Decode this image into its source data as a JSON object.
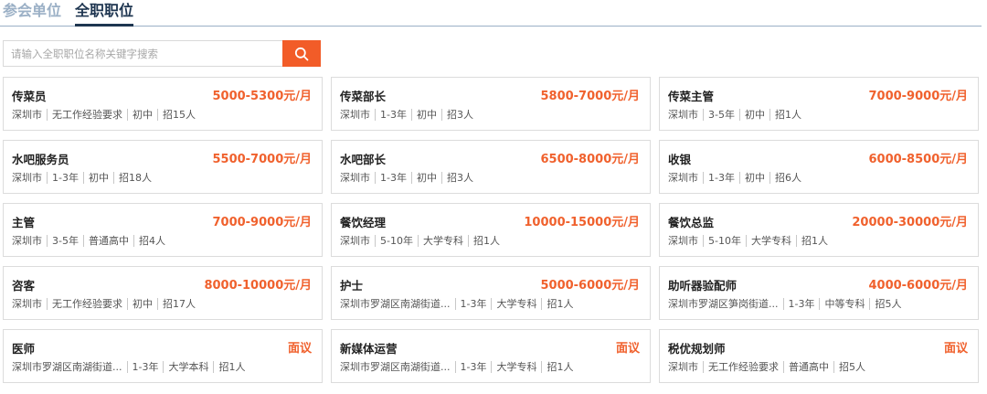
{
  "tabs": {
    "companies": "参会单位",
    "jobs": "全职职位"
  },
  "search": {
    "placeholder": "请输入全职职位名称关键字搜索"
  },
  "jobs": [
    {
      "title": "传菜员",
      "salary": "5000-5300元/月",
      "location": "深圳市",
      "experience": "无工作经验要求",
      "education": "初中",
      "headcount": "招15人"
    },
    {
      "title": "传菜部长",
      "salary": "5800-7000元/月",
      "location": "深圳市",
      "experience": "1-3年",
      "education": "初中",
      "headcount": "招3人"
    },
    {
      "title": "传菜主管",
      "salary": "7000-9000元/月",
      "location": "深圳市",
      "experience": "3-5年",
      "education": "初中",
      "headcount": "招1人"
    },
    {
      "title": "水吧服务员",
      "salary": "5500-7000元/月",
      "location": "深圳市",
      "experience": "1-3年",
      "education": "初中",
      "headcount": "招18人"
    },
    {
      "title": "水吧部长",
      "salary": "6500-8000元/月",
      "location": "深圳市",
      "experience": "1-3年",
      "education": "初中",
      "headcount": "招3人"
    },
    {
      "title": "收银",
      "salary": "6000-8500元/月",
      "location": "深圳市",
      "experience": "1-3年",
      "education": "初中",
      "headcount": "招6人"
    },
    {
      "title": "主管",
      "salary": "7000-9000元/月",
      "location": "深圳市",
      "experience": "3-5年",
      "education": "普通高中",
      "headcount": "招4人"
    },
    {
      "title": "餐饮经理",
      "salary": "10000-15000元/月",
      "location": "深圳市",
      "experience": "5-10年",
      "education": "大学专科",
      "headcount": "招1人"
    },
    {
      "title": "餐饮总监",
      "salary": "20000-30000元/月",
      "location": "深圳市",
      "experience": "5-10年",
      "education": "大学专科",
      "headcount": "招1人"
    },
    {
      "title": "咨客",
      "salary": "8000-10000元/月",
      "location": "深圳市",
      "experience": "无工作经验要求",
      "education": "初中",
      "headcount": "招17人"
    },
    {
      "title": "护士",
      "salary": "5000-6000元/月",
      "location": "深圳市罗湖区南湖街道...",
      "experience": "1-3年",
      "education": "大学专科",
      "headcount": "招1人"
    },
    {
      "title": "助听器验配师",
      "salary": "4000-6000元/月",
      "location": "深圳市罗湖区笋岗街道...",
      "experience": "1-3年",
      "education": "中等专科",
      "headcount": "招5人"
    },
    {
      "title": "医师",
      "salary": "面议",
      "location": "深圳市罗湖区南湖街道...",
      "experience": "1-3年",
      "education": "大学本科",
      "headcount": "招1人"
    },
    {
      "title": "新媒体运营",
      "salary": "面议",
      "location": "深圳市罗湖区南湖街道...",
      "experience": "1-3年",
      "education": "大学专科",
      "headcount": "招1人"
    },
    {
      "title": "税优规划师",
      "salary": "面议",
      "location": "深圳市",
      "experience": "无工作经验要求",
      "education": "普通高中",
      "headcount": "招5人"
    }
  ],
  "colors": {
    "accent": "#f25c28",
    "salary": "#f0612d",
    "tab_active": "#1e3550",
    "tab_inactive": "#9bb0c6"
  },
  "icons": {
    "search_button": "search-icon"
  }
}
